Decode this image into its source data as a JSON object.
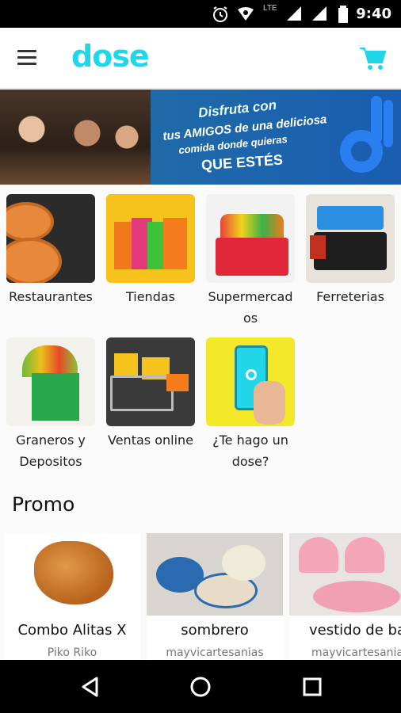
{
  "status": {
    "time": "9:40",
    "network": "LTE"
  },
  "appbar": {
    "logo": "dose"
  },
  "banner": {
    "line1": "Disfruta con",
    "line2": "tus AMIGOS de una deliciosa",
    "line3": "comida donde quieras",
    "line4": "QUE ESTÉS"
  },
  "categories": [
    {
      "label": "Restaurantes"
    },
    {
      "label": "Tiendas"
    },
    {
      "label": "Supermercad\nos"
    },
    {
      "label": "Ferreterias"
    },
    {
      "label": "Graneros y\nDepositos"
    },
    {
      "label": "Ventas online"
    },
    {
      "label": "¿Te hago un\ndose?"
    }
  ],
  "promo": {
    "title": "Promo",
    "items": [
      {
        "name": "Combo Alitas X",
        "store": "Piko Riko"
      },
      {
        "name": "sombrero",
        "store": "mayvicartesanias"
      },
      {
        "name": "vestido de ba",
        "store": "mayvicartesania"
      }
    ]
  },
  "colors": {
    "brand": "#21d6e8",
    "banner_blue": "#1a5db0"
  }
}
